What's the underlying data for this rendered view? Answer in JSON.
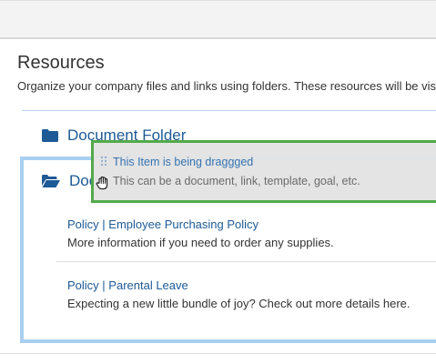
{
  "page": {
    "title": "Resources",
    "subtitle": "Organize your company files and links using folders. These resources will be visible to all"
  },
  "folders": [
    {
      "name": "Document Folder",
      "icon": "folder-icon",
      "state": "closed"
    },
    {
      "name": "Doc",
      "icon": "folder-open-icon",
      "state": "open"
    }
  ],
  "items": [
    {
      "category": "Policy",
      "separator": " | ",
      "name": "Employee Purchasing Policy",
      "description": "More information if you need to order any supplies."
    },
    {
      "category": "Policy",
      "separator": " | ",
      "name": "Parental Leave",
      "description": "Expecting a new little bundle of joy? Check out more details here."
    }
  ],
  "dragged_item": {
    "title": "This Item is being draggged",
    "description": "This can be a document, link, template, goal, etc.",
    "handle_icon": "drag-handle-icon",
    "cursor_icon": "grab-hand-icon"
  },
  "colors": {
    "link": "#1e5a96",
    "drag_border": "#4ea845",
    "drop_zone": "#a8cff0"
  }
}
